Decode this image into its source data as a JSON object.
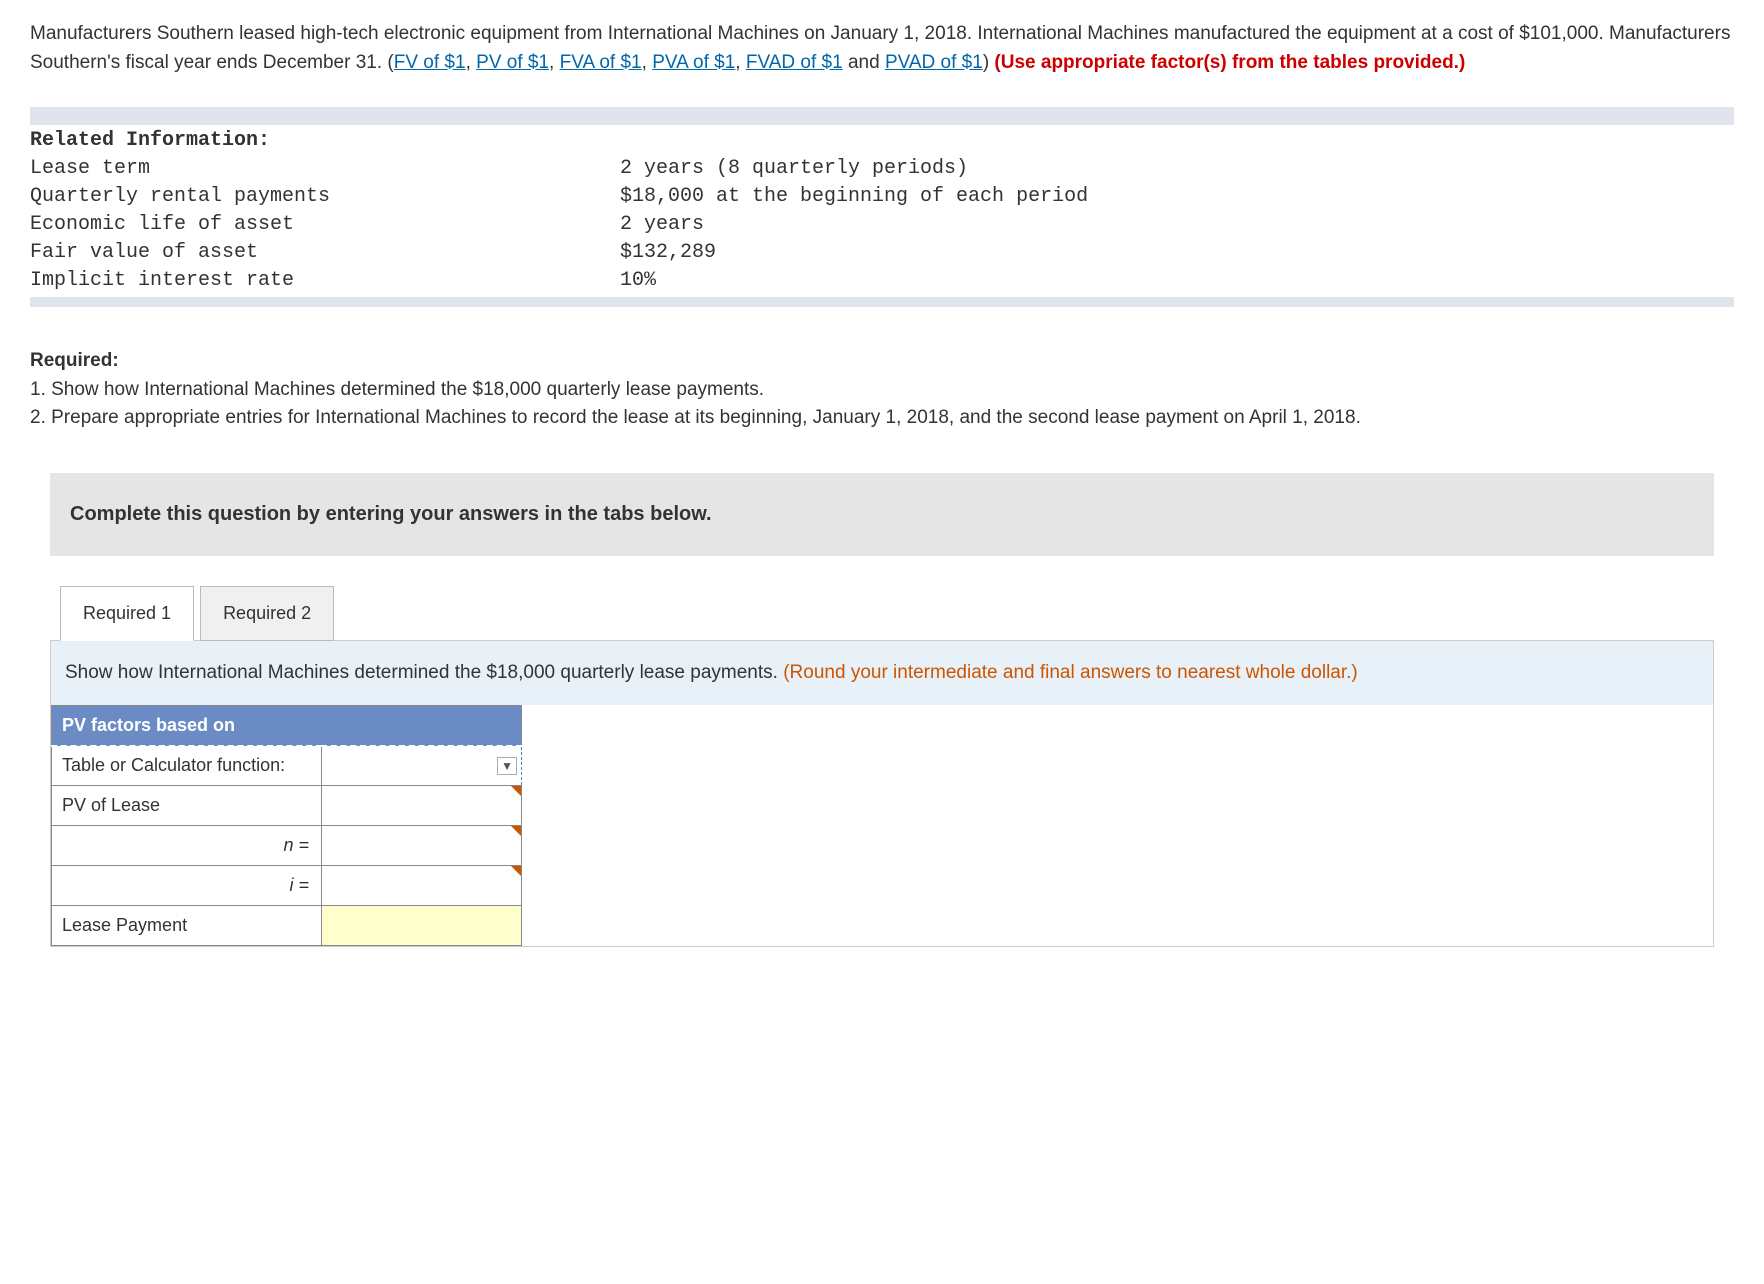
{
  "intro": {
    "part1": "Manufacturers Southern leased high-tech electronic equipment from International Machines on January 1, 2018. International Machines manufactured the equipment at a cost of $101,000. Manufacturers Southern's fiscal year ends December 31. (",
    "link1": "FV of $1",
    "sep": ", ",
    "link2": "PV of $1",
    "link3": "FVA of $1",
    "link4": "PVA of $1",
    "link5": "FVAD of $1",
    "and": " and ",
    "link6": "PVAD of $1",
    "part2": ") ",
    "redtext": "(Use appropriate factor(s) from the tables provided.)"
  },
  "info": {
    "heading": "Related Information:",
    "rows": [
      {
        "k": "Lease term",
        "v": "2 years (8 quarterly periods)"
      },
      {
        "k": "Quarterly rental payments",
        "v": "$18,000 at the beginning of each period"
      },
      {
        "k": "Economic life of asset",
        "v": "2 years"
      },
      {
        "k": "Fair value of asset",
        "v": "$132,289"
      },
      {
        "k": "Implicit interest rate",
        "v": "10%"
      }
    ]
  },
  "required": {
    "heading": "Required:",
    "item1": "1. Show how International Machines determined the $18,000 quarterly lease payments.",
    "item2": "2. Prepare appropriate entries for International Machines to record the lease at its beginning, January 1, 2018, and the second lease payment on April 1, 2018."
  },
  "instruction": "Complete this question by entering your answers in the tabs below.",
  "tabs": {
    "tab1": "Required 1",
    "tab2": "Required 2"
  },
  "prompt": {
    "main": "Show how International Machines determined the $18,000 quarterly lease payments. ",
    "note": "(Round your intermediate and final answers to nearest whole dollar.)"
  },
  "table": {
    "header": "PV factors based on",
    "r1": "Table or Calculator function:",
    "r2": "PV of Lease",
    "r3": "n =",
    "r4": "i =",
    "r5": "Lease Payment"
  }
}
